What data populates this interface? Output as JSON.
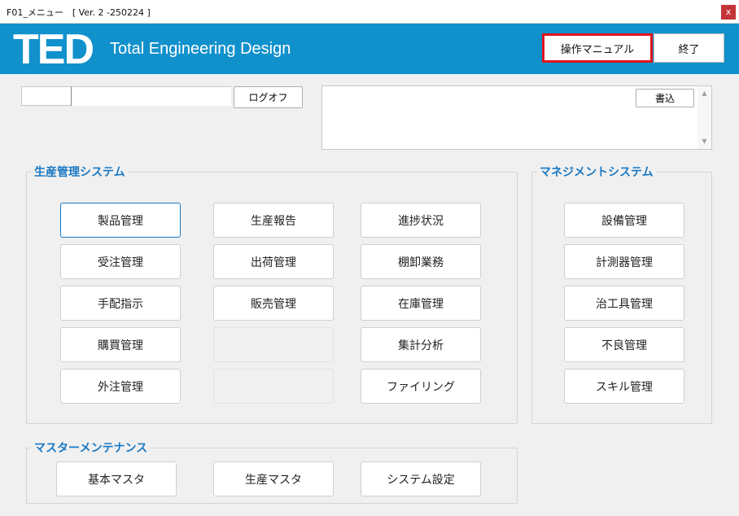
{
  "window": {
    "title": "F01_メニュー　[ Ver. 2 -250224 ]",
    "close_label": "x"
  },
  "header": {
    "logo": "TED",
    "tagline": "Total Engineering Design",
    "manual_button": "操作マニュアル",
    "exit_button": "終了",
    "accent_color": "#1191cc",
    "highlight_color": "#e0141e"
  },
  "user_bar": {
    "user_id": "",
    "user_name": "",
    "logoff_button": "ログオフ"
  },
  "memo": {
    "text": "",
    "write_button": "書込"
  },
  "production": {
    "title": "生産管理システム",
    "col1": [
      "製品管理",
      "受注管理",
      "手配指示",
      "購買管理",
      "外注管理"
    ],
    "col2": [
      "生産報告",
      "出荷管理",
      "販売管理",
      "",
      ""
    ],
    "col3": [
      "進捗状況",
      "棚卸業務",
      "在庫管理",
      "集計分析",
      "ファイリング"
    ]
  },
  "management": {
    "title": "マネジメントシステム",
    "items": [
      "設備管理",
      "計測器管理",
      "治工具管理",
      "不良管理",
      "スキル管理"
    ]
  },
  "master": {
    "title": "マスターメンテナンス",
    "items": [
      "基本マスタ",
      "生産マスタ",
      "システム設定"
    ]
  }
}
